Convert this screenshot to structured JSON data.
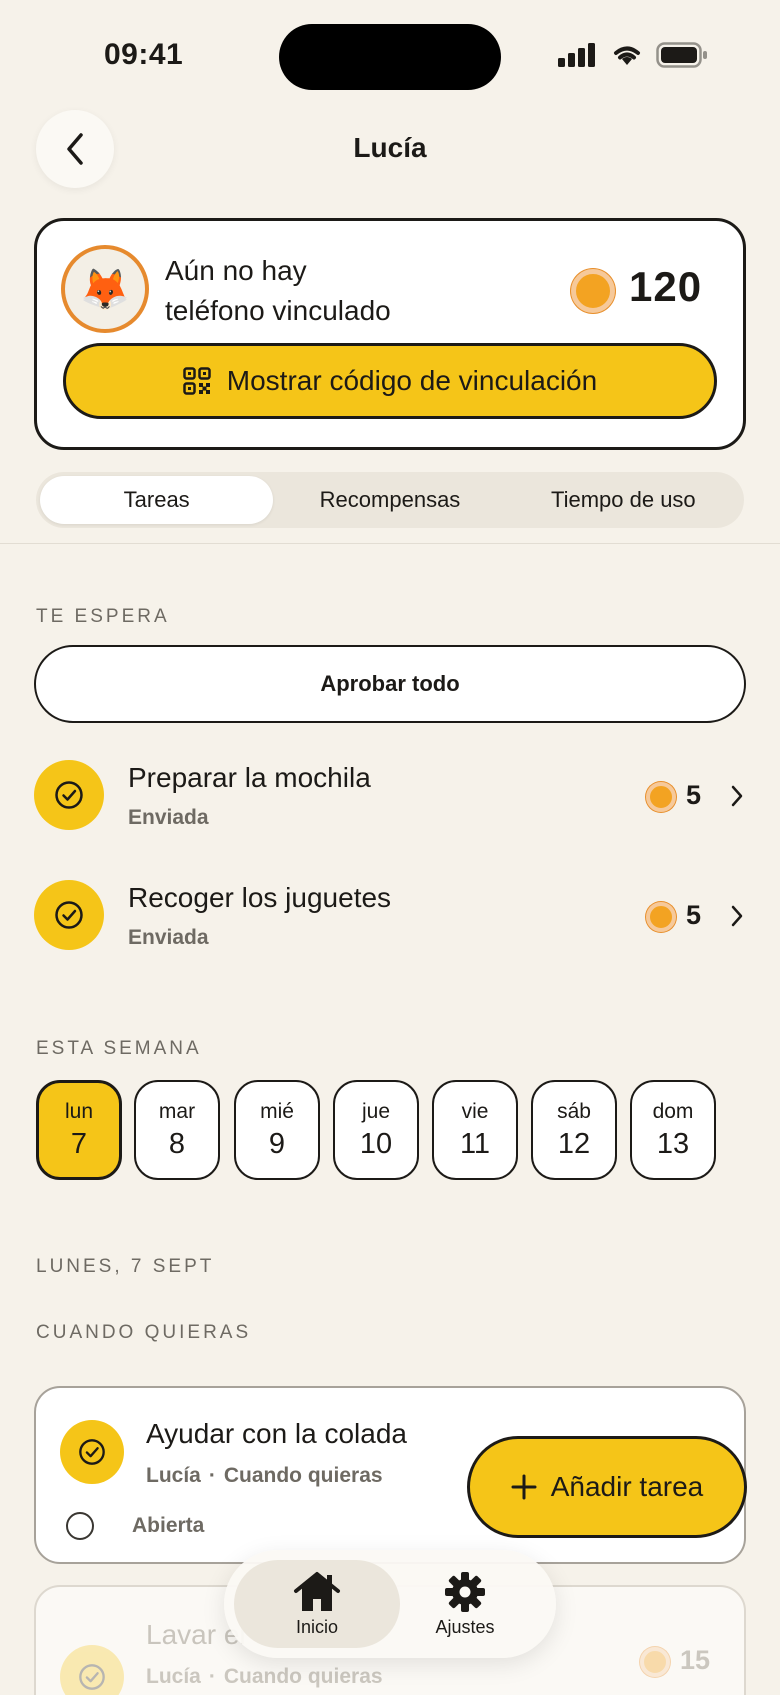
{
  "status_bar": {
    "time": "09:41"
  },
  "header": {
    "title": "Lucía",
    "back_icon": "chevron-left-icon"
  },
  "profile": {
    "avatar_emoji": "🦊",
    "link_status_line1": "Aún no hay",
    "link_status_line2": "teléfono vinculado",
    "coins": "120",
    "code_button_label": "Mostrar código de vinculación",
    "code_button_icon": "qr-code-icon"
  },
  "tabs": [
    {
      "label": "Tareas",
      "active": true
    },
    {
      "label": "Recompensas",
      "active": false
    },
    {
      "label": "Tiempo de uso",
      "active": false
    }
  ],
  "pending": {
    "section_label": "TE ESPERA",
    "approve_all_label": "Aprobar todo",
    "items": [
      {
        "title": "Preparar la mochila",
        "status": "Enviada",
        "coins": "5"
      },
      {
        "title": "Recoger los juguetes",
        "status": "Enviada",
        "coins": "5"
      }
    ]
  },
  "week": {
    "section_label": "ESTA SEMANA",
    "days": [
      {
        "name": "lun",
        "num": "7",
        "active": true
      },
      {
        "name": "mar",
        "num": "8",
        "active": false
      },
      {
        "name": "mié",
        "num": "9",
        "active": false
      },
      {
        "name": "jue",
        "num": "10",
        "active": false
      },
      {
        "name": "vie",
        "num": "11",
        "active": false
      },
      {
        "name": "sáb",
        "num": "12",
        "active": false
      },
      {
        "name": "dom",
        "num": "13",
        "active": false
      }
    ]
  },
  "day_section": {
    "date_label": "LUNES, 7 SEPT",
    "group_label": "CUANDO QUIERAS",
    "tasks": [
      {
        "title": "Ayudar con la colada",
        "assignee": "Lucía",
        "separator": "·",
        "schedule": "Cuando quieras",
        "state": "Abierta"
      },
      {
        "title": "Lavar el",
        "assignee": "Lucía",
        "separator": "·",
        "schedule": "Cuando quieras",
        "coins": "15"
      }
    ]
  },
  "add_task_label": "Añadir tarea",
  "bottom_nav": [
    {
      "label": "Inicio",
      "icon": "home-icon",
      "active": true
    },
    {
      "label": "Ajustes",
      "icon": "gear-icon",
      "active": false
    }
  ],
  "colors": {
    "accent": "#f5c518",
    "coin": "#f3a322",
    "background": "#f6f2ea",
    "ink": "#1c1a17"
  }
}
